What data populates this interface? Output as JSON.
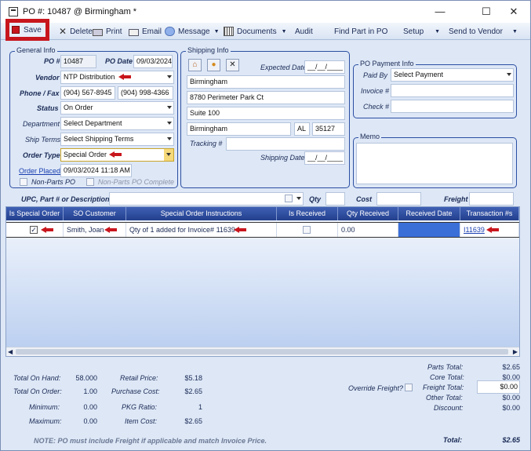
{
  "window": {
    "title": "PO #: 10487 @ Birmingham *"
  },
  "toolbar": {
    "save": "Save",
    "delete": "Delete",
    "print": "Print",
    "email": "Email",
    "message": "Message",
    "documents": "Documents",
    "audit": "Audit",
    "find_part": "Find Part in PO",
    "setup": "Setup",
    "send_to_vendor": "Send to Vendor"
  },
  "general": {
    "legend": "General Info",
    "po_num_label": "PO #",
    "po_num": "10487",
    "po_date_label": "PO Date",
    "po_date": "09/03/2024",
    "vendor_label": "Vendor",
    "vendor": "NTP Distribution",
    "phone_label": "Phone / Fax",
    "phone": "(904) 567-8945",
    "fax": "(904) 998-4366",
    "status_label": "Status",
    "status": "On Order",
    "department_label": "Department",
    "department": "Select Department",
    "ship_terms_label": "Ship Terms",
    "ship_terms": "Select Shipping Terms",
    "order_type_label": "Order Type",
    "order_type": "Special Order",
    "order_placed_label": "Order Placed",
    "order_placed": "09/03/2024 11:18 AM",
    "non_parts_po": "Non-Parts PO",
    "non_parts_po_complete": "Non-Parts PO Complete"
  },
  "shipping": {
    "legend": "Shipping Info",
    "expected_date_label": "Expected Date",
    "expected_date": "__/__/____",
    "name": "Birmingham",
    "address1": "8780 Perimeter Park Ct",
    "address2": "Suite 100",
    "city": "Birmingham",
    "state": "AL",
    "zip": "35127",
    "tracking_label": "Tracking #",
    "tracking": "",
    "shipping_date_label": "Shipping Date",
    "shipping_date": "__/__/____"
  },
  "payment": {
    "legend": "PO Payment Info",
    "paid_by_label": "Paid By",
    "paid_by": "Select Payment",
    "invoice_label": "Invoice #",
    "invoice": "",
    "check_label": "Check #",
    "check": ""
  },
  "memo": {
    "legend": "Memo",
    "text": ""
  },
  "search": {
    "upc_label": "UPC, Part # or Description",
    "qty_label": "Qty",
    "cost_label": "Cost",
    "freight_label": "Freight"
  },
  "grid": {
    "columns": [
      "Is Special Order",
      "SO Customer",
      "Special Order Instructions",
      "Is Received",
      "Qty Received",
      "Received Date",
      "Transaction #s"
    ],
    "rows": [
      {
        "is_special_order": true,
        "so_customer": "Smith, Joan",
        "instructions": "Qty of 1 added for Invoice# 11639",
        "is_received": false,
        "qty_received": "0.00",
        "received_date": "",
        "transaction": "I11639"
      }
    ]
  },
  "stats": {
    "total_on_hand_label": "Total On Hand:",
    "total_on_hand": "58.000",
    "total_on_order_label": "Total On Order:",
    "total_on_order": "1.00",
    "minimum_label": "Minimum:",
    "minimum": "0.00",
    "maximum_label": "Maximum:",
    "maximum": "0.00",
    "retail_price_label": "Retail Price:",
    "retail_price": "$5.18",
    "purchase_cost_label": "Purchase Cost:",
    "purchase_cost": "$2.65",
    "pkg_ratio_label": "PKG Ratio:",
    "pkg_ratio": "1",
    "item_cost_label": "Item Cost:",
    "item_cost": "$2.65"
  },
  "totals": {
    "override_freight_label": "Override Freight?",
    "parts_total_label": "Parts Total:",
    "parts_total": "$2.65",
    "core_total_label": "Core Total:",
    "core_total": "$0.00",
    "freight_total_label": "Freight Total:",
    "freight_total": "$0.00",
    "other_total_label": "Other Total:",
    "other_total": "$0.00",
    "discount_label": "Discount:",
    "discount": "$0.00",
    "total_label": "Total:",
    "total": "$2.65"
  },
  "note": "NOTE: PO must include Freight if applicable and match Invoice Price.",
  "colors": {
    "accent": "#2b4ea1",
    "header": "#233f8d",
    "highlight": "#c8161d",
    "selected_cell": "#3a6fd8"
  }
}
